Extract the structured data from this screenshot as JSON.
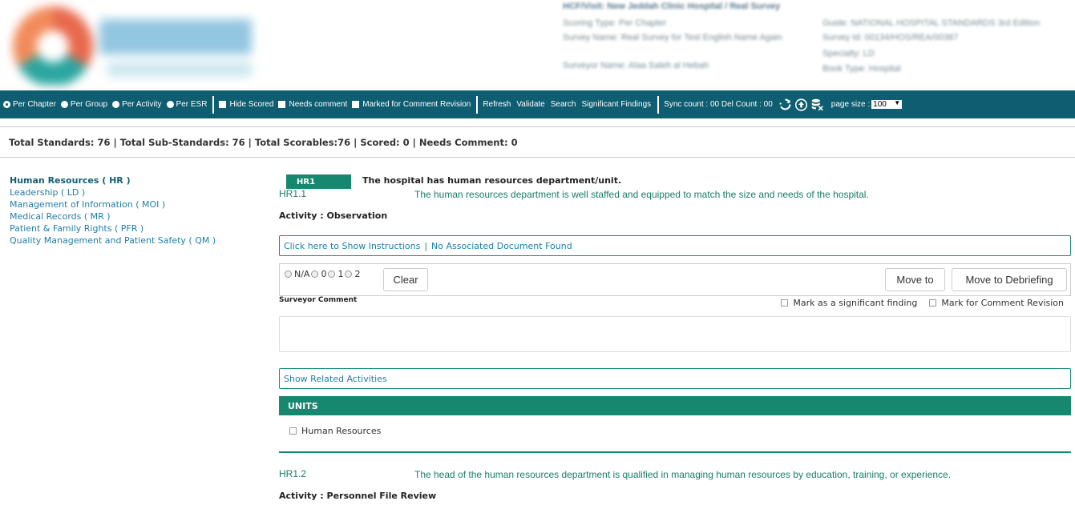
{
  "header": {
    "survey_title": "HCF/Visit: New Jeddah Clinic Hospital / Real Survey",
    "scoring_type": "Scoring Type: Per Chapter",
    "survey_name": "Survey Name: Real Survey for Test English Name Again",
    "surveyor_name": "Surveyor Name: Alaa Saleh al Hebah",
    "guide": "Guide: NATIONAL HOSPITAL STANDARDS 3rd Edition",
    "survey_id": "Survey Id: 00134/HOS/REA/00387",
    "specialty": "Specialty: LD",
    "book_type": "Book Type: Hospital"
  },
  "toolbar": {
    "view_options": [
      "Per Chapter",
      "Per Group",
      "Per Activity",
      "Per ESR"
    ],
    "selected_view": "Per Chapter",
    "filters": [
      "Hide Scored",
      "Needs comment",
      "Marked for Comment Revision"
    ],
    "actions": [
      "Refresh",
      "Validate",
      "Search",
      "Significant Findings"
    ],
    "sync_text": "Sync count : 00 Del Count : 00",
    "page_size_label": "page size :",
    "page_size_value": "100",
    "icons": [
      "sync-icon",
      "upload-icon",
      "database-delete-icon"
    ]
  },
  "totals": "Total Standards: 76 | Total Sub-Standards: 76 | Total Scorables:76 | Scored: 0 | Needs Comment: 0",
  "sidebar": {
    "items": [
      {
        "label": "Human Resources ( HR )",
        "active": true
      },
      {
        "label": "Leadership ( LD )",
        "active": false
      },
      {
        "label": "Management of Information ( MOI )",
        "active": false
      },
      {
        "label": "Medical Records ( MR )",
        "active": false
      },
      {
        "label": "Patient & Family Rights ( PFR )",
        "active": false
      },
      {
        "label": "Quality Management and Patient Safety ( QM )",
        "active": false
      }
    ]
  },
  "standard": {
    "code": "HR1",
    "text": "The hospital has human resources department/unit."
  },
  "sub_standards": [
    {
      "id": "HR1.1",
      "text": "The human resources department is well staffed and equipped to match the size and needs of the hospital.",
      "activity_label": "Activity :",
      "activity": "Observation",
      "instructions_link": "Click here to Show Instructions",
      "doc_link": "No Associated Document Found",
      "score_options": [
        "N/A",
        "0",
        "1",
        "2"
      ],
      "clear_label": "Clear",
      "move_to_label": "Move to",
      "move_debrief_label": "Move to Debriefing",
      "surveyor_comment_label": "Surveyor Comment",
      "mark_significant_label": "Mark as a significant finding",
      "mark_revision_label": "Mark for Comment Revision",
      "related_label": "Show Related Activities",
      "units_label": "UNITS",
      "units": [
        "Human Resources"
      ]
    },
    {
      "id": "HR1.2",
      "text": "The head of the human resources department is qualified in managing human resources by education, training, or experience.",
      "activity_label": "Activity :",
      "activity": "Personnel File Review"
    }
  ]
}
